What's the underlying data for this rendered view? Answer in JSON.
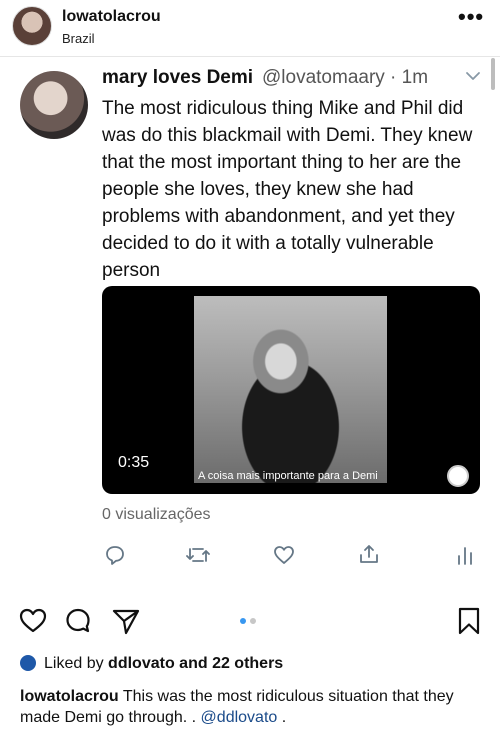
{
  "post": {
    "username": "lowatolacrou",
    "location": "Brazil",
    "more_icon": "•••"
  },
  "tweet": {
    "name": "mary loves Demi",
    "handle_time": "@lovatomaary · 1m",
    "text": "The most ridiculous thing Mike and Phil did was do this blackmail with Demi. They knew that the most important thing to her are the people she loves, they knew she had problems with abandonment, and yet they decided to do it with a totally vulnerable person",
    "video": {
      "time": "0:35",
      "caption": "A coisa mais importante para a Demi"
    },
    "views": "0 visualizações",
    "actions": [
      "reply-icon",
      "retweet-icon",
      "like-icon",
      "share-icon",
      "analytics-icon"
    ]
  },
  "instagram_bar": {
    "icons": [
      "heart-icon",
      "comment-icon",
      "send-icon",
      "bookmark-icon"
    ],
    "carousel_dots": 2,
    "active_dot": 1
  },
  "likes": {
    "liked_by_label": "Liked by",
    "user": "ddlovato",
    "rest": "and 22 others"
  },
  "caption": {
    "username": "lowatolacrou",
    "text": "This was the most ridiculous situation that they made Demi go through. .",
    "mention": "@ddlovato",
    "end": "."
  },
  "colors": {
    "accent_blue": "#3897f0",
    "mention_blue": "#1b4b8a",
    "likes_avatar": "#1e58a8"
  }
}
